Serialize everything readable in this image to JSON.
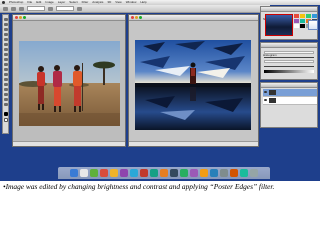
{
  "app": {
    "name": "Photoshop",
    "menus": [
      "File",
      "Edit",
      "Image",
      "Layer",
      "Select",
      "Filter",
      "Analysis",
      "3D",
      "View",
      "Window",
      "Help"
    ]
  },
  "panels": {
    "navigator_title": "Navigator",
    "histogram_title": "Histogram",
    "layers_title": "Layers"
  },
  "caption": "•Image was edited by  changing brightness and contrast and applying “Poster Edges” filter.",
  "colors": {
    "desktop": "#1e3f8c",
    "dock_items": [
      "#3a7bd5",
      "#e8e8e8",
      "#5fb13a",
      "#d94c3b",
      "#f0b429",
      "#8e44ad",
      "#2ba8d8",
      "#c0392b",
      "#16a085",
      "#e67e22",
      "#34495e",
      "#27ae60",
      "#9b59b6",
      "#f39c12",
      "#2980b9",
      "#7f8c8d",
      "#d35400",
      "#1abc9c",
      "#95a5a6"
    ]
  }
}
